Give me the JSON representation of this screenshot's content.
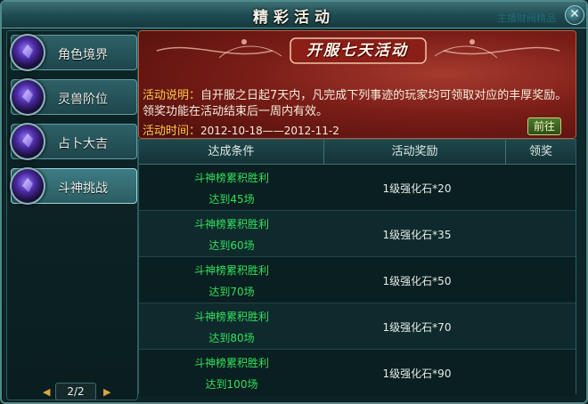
{
  "window": {
    "title": "精彩活动",
    "ghost_text": "主播财阀精品"
  },
  "sidebar": {
    "items": [
      {
        "label": "角色境界"
      },
      {
        "label": "灵兽阶位"
      },
      {
        "label": "占卜大吉"
      },
      {
        "label": "斗神挑战"
      }
    ],
    "active_index": 3,
    "pager": {
      "text": "2/2",
      "prev": "◀",
      "next": "▶"
    }
  },
  "banner": {
    "title": "开服七天活动",
    "desc_key": "活动说明：",
    "desc_text": "自开服之日起7天内，凡完成下列事迹的玩家均可领取对应的丰厚奖励。领奖功能在活动结束后一周内有效。",
    "time_key": "活动时间：",
    "time_text": "2012-10-18——2012-11-2",
    "goto_label": "前往"
  },
  "table": {
    "headers": [
      "达成条件",
      "活动奖励",
      "领奖"
    ],
    "rows": [
      {
        "cond1": "斗神榜累积胜利",
        "cond2": "达到45场",
        "reward": "1级强化石*20"
      },
      {
        "cond1": "斗神榜累积胜利",
        "cond2": "达到60场",
        "reward": "1级强化石*35"
      },
      {
        "cond1": "斗神榜累积胜利",
        "cond2": "达到70场",
        "reward": "1级强化石*50"
      },
      {
        "cond1": "斗神榜累积胜利",
        "cond2": "达到80场",
        "reward": "1级强化石*70"
      },
      {
        "cond1": "斗神榜累积胜利",
        "cond2": "达到100场",
        "reward": "1级强化石*90"
      }
    ]
  },
  "colors": {
    "accent_gold": "#ffc94a",
    "condition_green": "#32e05a",
    "banner_red": "#7a1d17"
  }
}
